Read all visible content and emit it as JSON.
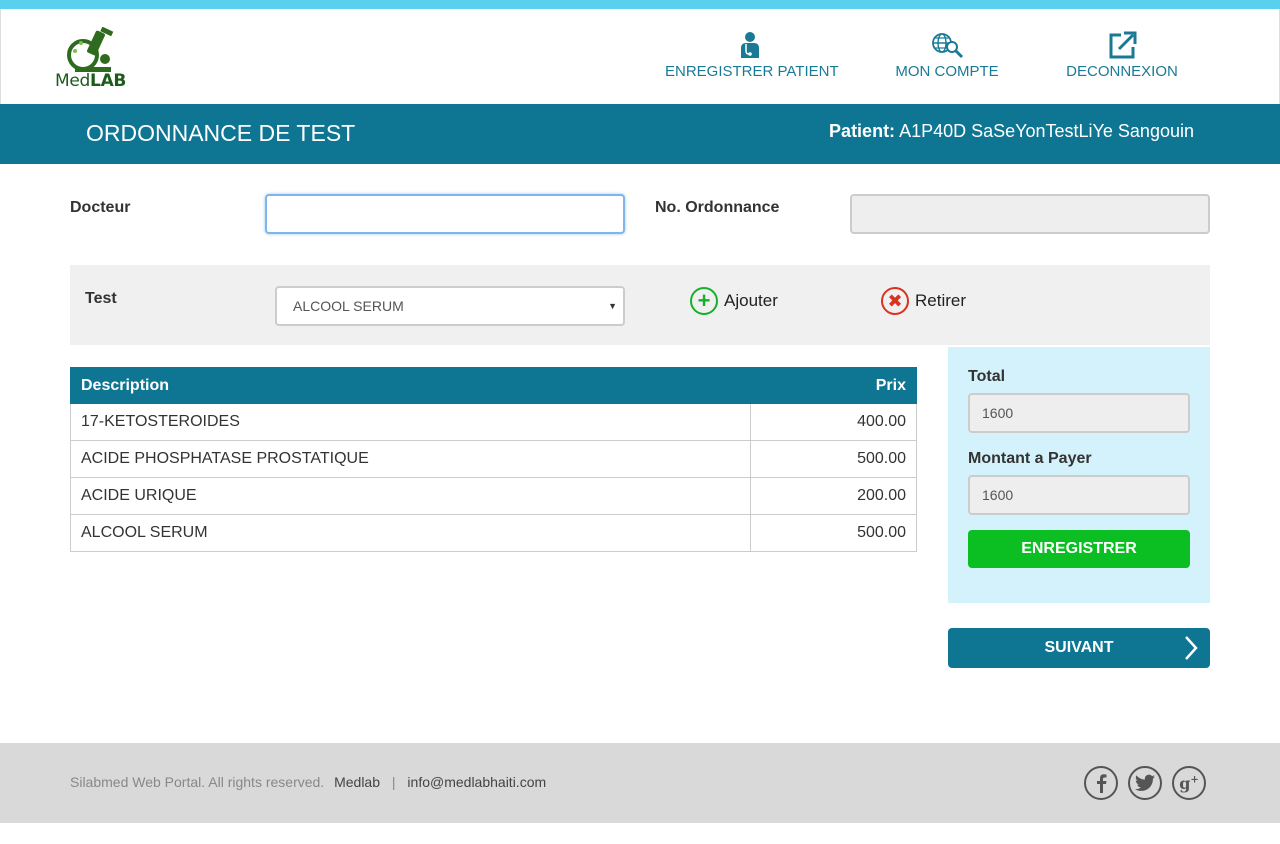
{
  "brand": {
    "logo_prefix": "Med",
    "logo_suffix": "LAB"
  },
  "nav": [
    {
      "label": "ENREGISTRER PATIENT",
      "icon": "doctor-icon"
    },
    {
      "label": "MON COMPTE",
      "icon": "globe-search-icon"
    },
    {
      "label": "DECONNEXION",
      "icon": "external-link-icon"
    }
  ],
  "titlebar": {
    "title": "ORDONNANCE DE TEST",
    "patient_label": "Patient:",
    "patient_value": "A1P40D SaSeYonTestLiYe Sangouin"
  },
  "form": {
    "doctor_label": "Docteur",
    "doctor_value": "",
    "ordonnance_label": "No. Ordonnance",
    "ordonnance_value": ""
  },
  "testbar": {
    "label": "Test",
    "selected": "ALCOOL SERUM",
    "add_label": "Ajouter",
    "remove_label": "Retirer"
  },
  "table": {
    "headers": {
      "description": "Description",
      "price": "Prix"
    },
    "rows": [
      {
        "description": "17-KETOSTEROIDES",
        "price": "400.00"
      },
      {
        "description": "ACIDE PHOSPHATASE PROSTATIQUE",
        "price": "500.00"
      },
      {
        "description": "ACIDE URIQUE",
        "price": "200.00"
      },
      {
        "description": "ALCOOL SERUM",
        "price": "500.00"
      }
    ]
  },
  "summary": {
    "total_label": "Total",
    "total_value": "1600",
    "pay_label": "Montant a Payer",
    "pay_value": "1600",
    "save_label": "ENREGISTRER"
  },
  "next_label": "SUIVANT",
  "footer": {
    "copyright": "Silabmed Web Portal. All rights reserved.",
    "link1": "Medlab",
    "separator": "|",
    "email": "info@medlabhaiti.com"
  },
  "colors": {
    "accent": "#0e7693",
    "topbar": "#5bcfee",
    "green": "#0bbf22",
    "panel": "#d4f2fb"
  }
}
